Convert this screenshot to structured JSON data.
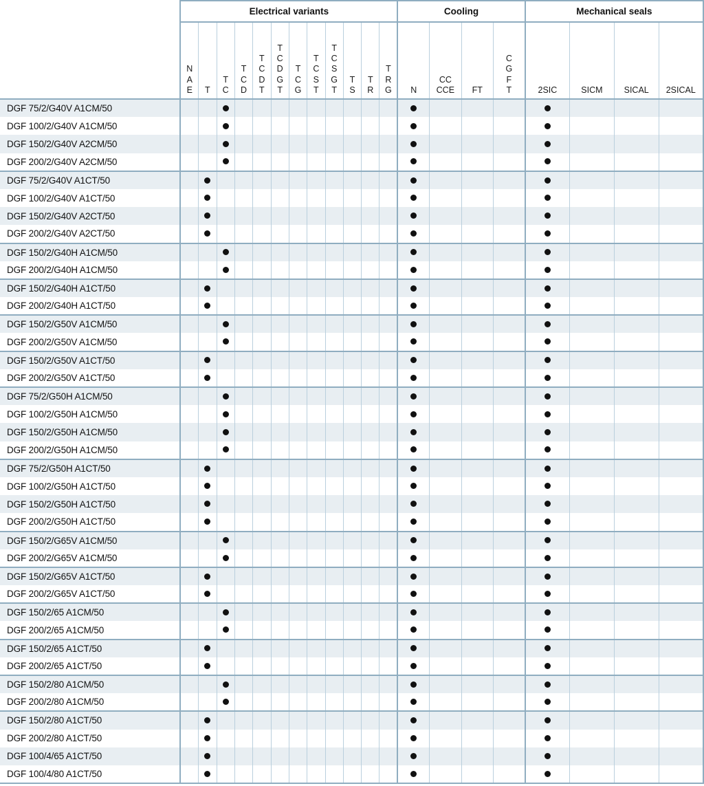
{
  "table": {
    "column_groups": [
      {
        "id": "electrical",
        "label": "Electrical variants",
        "span": 12
      },
      {
        "id": "cooling",
        "label": "Cooling",
        "span": 4
      },
      {
        "id": "seals",
        "label": "Mechanical seals",
        "span": 4
      }
    ],
    "columns": [
      {
        "group": "electrical",
        "key": "NAE",
        "lines": [
          "N",
          "A",
          "E"
        ]
      },
      {
        "group": "electrical",
        "key": "T",
        "lines": [
          "T"
        ]
      },
      {
        "group": "electrical",
        "key": "TC",
        "lines": [
          "T",
          "C"
        ]
      },
      {
        "group": "electrical",
        "key": "TCD",
        "lines": [
          "T",
          "C",
          "D"
        ]
      },
      {
        "group": "electrical",
        "key": "TCDT",
        "lines": [
          "T",
          "C",
          "D",
          "T"
        ]
      },
      {
        "group": "electrical",
        "key": "TCDGT",
        "lines": [
          "T",
          "C",
          "D",
          "G",
          "T"
        ]
      },
      {
        "group": "electrical",
        "key": "TCG",
        "lines": [
          "T",
          "C",
          "G"
        ]
      },
      {
        "group": "electrical",
        "key": "TCST",
        "lines": [
          "T",
          "C",
          "S",
          "T"
        ]
      },
      {
        "group": "electrical",
        "key": "TCSGT",
        "lines": [
          "T",
          "C",
          "S",
          "G",
          "T"
        ]
      },
      {
        "group": "electrical",
        "key": "TS",
        "lines": [
          "T",
          "S"
        ]
      },
      {
        "group": "electrical",
        "key": "TR",
        "lines": [
          "T",
          "R"
        ]
      },
      {
        "group": "electrical",
        "key": "TRG",
        "lines": [
          "T",
          "R",
          "G"
        ]
      },
      {
        "group": "cooling",
        "key": "N",
        "lines": [
          "N"
        ]
      },
      {
        "group": "cooling",
        "key": "CC_CCE",
        "lines": [
          "CC",
          "CCE"
        ]
      },
      {
        "group": "cooling",
        "key": "FT",
        "lines": [
          "FT"
        ]
      },
      {
        "group": "cooling",
        "key": "CGFT",
        "lines": [
          "C",
          "G",
          "F",
          "T"
        ]
      },
      {
        "group": "seals",
        "key": "2SIC",
        "lines": [
          "2SIC"
        ]
      },
      {
        "group": "seals",
        "key": "SICM",
        "lines": [
          "SICM"
        ]
      },
      {
        "group": "seals",
        "key": "SICAL",
        "lines": [
          "SICAL"
        ]
      },
      {
        "group": "seals",
        "key": "2SICAL",
        "lines": [
          "2SICAL"
        ]
      }
    ],
    "row_groups": [
      {
        "rows": [
          {
            "label": "DGF 75/2/G40V A1CM/50",
            "marks": [
              "TC",
              "N",
              "2SIC"
            ]
          },
          {
            "label": "DGF 100/2/G40V A1CM/50",
            "marks": [
              "TC",
              "N",
              "2SIC"
            ]
          },
          {
            "label": "DGF 150/2/G40V A2CM/50",
            "marks": [
              "TC",
              "N",
              "2SIC"
            ]
          },
          {
            "label": "DGF 200/2/G40V A2CM/50",
            "marks": [
              "TC",
              "N",
              "2SIC"
            ]
          }
        ]
      },
      {
        "rows": [
          {
            "label": "DGF 75/2/G40V A1CT/50",
            "marks": [
              "T",
              "N",
              "2SIC"
            ]
          },
          {
            "label": "DGF 100/2/G40V A1CT/50",
            "marks": [
              "T",
              "N",
              "2SIC"
            ]
          },
          {
            "label": "DGF 150/2/G40V A2CT/50",
            "marks": [
              "T",
              "N",
              "2SIC"
            ]
          },
          {
            "label": "DGF 200/2/G40V A2CT/50",
            "marks": [
              "T",
              "N",
              "2SIC"
            ]
          }
        ]
      },
      {
        "rows": [
          {
            "label": "DGF 150/2/G40H A1CM/50",
            "marks": [
              "TC",
              "N",
              "2SIC"
            ]
          },
          {
            "label": "DGF 200/2/G40H A1CM/50",
            "marks": [
              "TC",
              "N",
              "2SIC"
            ]
          }
        ]
      },
      {
        "rows": [
          {
            "label": "DGF 150/2/G40H A1CT/50",
            "marks": [
              "T",
              "N",
              "2SIC"
            ]
          },
          {
            "label": "DGF 200/2/G40H A1CT/50",
            "marks": [
              "T",
              "N",
              "2SIC"
            ]
          }
        ]
      },
      {
        "rows": [
          {
            "label": "DGF 150/2/G50V A1CM/50",
            "marks": [
              "TC",
              "N",
              "2SIC"
            ]
          },
          {
            "label": "DGF 200/2/G50V A1CM/50",
            "marks": [
              "TC",
              "N",
              "2SIC"
            ]
          }
        ]
      },
      {
        "rows": [
          {
            "label": "DGF 150/2/G50V A1CT/50",
            "marks": [
              "T",
              "N",
              "2SIC"
            ]
          },
          {
            "label": "DGF 200/2/G50V A1CT/50",
            "marks": [
              "T",
              "N",
              "2SIC"
            ]
          }
        ]
      },
      {
        "rows": [
          {
            "label": "DGF 75/2/G50H A1CM/50",
            "marks": [
              "TC",
              "N",
              "2SIC"
            ]
          },
          {
            "label": "DGF 100/2/G50H A1CM/50",
            "marks": [
              "TC",
              "N",
              "2SIC"
            ]
          },
          {
            "label": "DGF 150/2/G50H A1CM/50",
            "marks": [
              "TC",
              "N",
              "2SIC"
            ]
          },
          {
            "label": "DGF 200/2/G50H A1CM/50",
            "marks": [
              "TC",
              "N",
              "2SIC"
            ]
          }
        ]
      },
      {
        "rows": [
          {
            "label": "DGF 75/2/G50H A1CT/50",
            "marks": [
              "T",
              "N",
              "2SIC"
            ]
          },
          {
            "label": "DGF 100/2/G50H A1CT/50",
            "marks": [
              "T",
              "N",
              "2SIC"
            ]
          },
          {
            "label": "DGF 150/2/G50H A1CT/50",
            "marks": [
              "T",
              "N",
              "2SIC"
            ]
          },
          {
            "label": "DGF 200/2/G50H A1CT/50",
            "marks": [
              "T",
              "N",
              "2SIC"
            ]
          }
        ]
      },
      {
        "rows": [
          {
            "label": "DGF 150/2/G65V A1CM/50",
            "marks": [
              "TC",
              "N",
              "2SIC"
            ]
          },
          {
            "label": "DGF 200/2/G65V A1CM/50",
            "marks": [
              "TC",
              "N",
              "2SIC"
            ]
          }
        ]
      },
      {
        "rows": [
          {
            "label": "DGF 150/2/G65V A1CT/50",
            "marks": [
              "T",
              "N",
              "2SIC"
            ]
          },
          {
            "label": "DGF 200/2/G65V A1CT/50",
            "marks": [
              "T",
              "N",
              "2SIC"
            ]
          }
        ]
      },
      {
        "rows": [
          {
            "label": "DGF 150/2/65 A1CM/50",
            "marks": [
              "TC",
              "N",
              "2SIC"
            ]
          },
          {
            "label": "DGF 200/2/65 A1CM/50",
            "marks": [
              "TC",
              "N",
              "2SIC"
            ]
          }
        ]
      },
      {
        "rows": [
          {
            "label": "DGF 150/2/65 A1CT/50",
            "marks": [
              "T",
              "N",
              "2SIC"
            ]
          },
          {
            "label": "DGF 200/2/65 A1CT/50",
            "marks": [
              "T",
              "N",
              "2SIC"
            ]
          }
        ]
      },
      {
        "rows": [
          {
            "label": "DGF 150/2/80 A1CM/50",
            "marks": [
              "TC",
              "N",
              "2SIC"
            ]
          },
          {
            "label": "DGF 200/2/80 A1CM/50",
            "marks": [
              "TC",
              "N",
              "2SIC"
            ]
          }
        ]
      },
      {
        "rows": [
          {
            "label": "DGF 150/2/80 A1CT/50",
            "marks": [
              "T",
              "N",
              "2SIC"
            ]
          },
          {
            "label": "DGF 200/2/80 A1CT/50",
            "marks": [
              "T",
              "N",
              "2SIC"
            ]
          },
          {
            "label": "DGF 100/4/65 A1CT/50",
            "marks": [
              "T",
              "N",
              "2SIC"
            ]
          },
          {
            "label": "DGF 100/4/80 A1CT/50",
            "marks": [
              "T",
              "N",
              "2SIC"
            ]
          }
        ]
      }
    ],
    "marker_glyph": "filled-dot",
    "colors": {
      "row_shade": "#e8eef2",
      "grid_line": "#b9cfdd",
      "group_rule": "#8fadc0",
      "marker": "#111111",
      "text": "#111111",
      "background": "#ffffff"
    }
  }
}
